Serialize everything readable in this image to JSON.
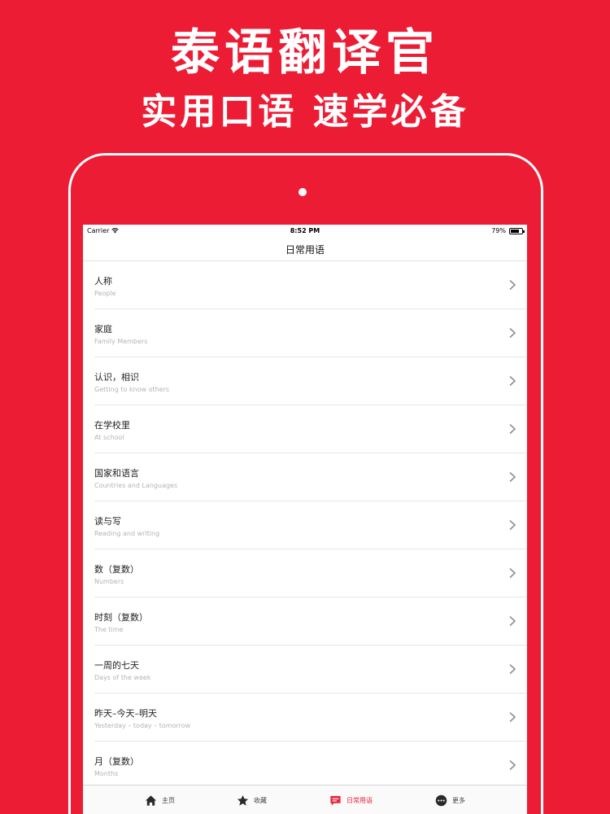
{
  "promo": {
    "title": "泰语翻译官",
    "subtitle": "实用口语 速学必备"
  },
  "status_bar": {
    "carrier": "Carrier",
    "time": "8:52 PM",
    "battery": "79%",
    "battery_level": 0.79
  },
  "nav": {
    "title": "日常用语"
  },
  "list": {
    "items": [
      {
        "title": "人称",
        "subtitle": "People"
      },
      {
        "title": "家庭",
        "subtitle": "Family Members"
      },
      {
        "title": "认识，相识",
        "subtitle": "Getting to know others"
      },
      {
        "title": "在学校里",
        "subtitle": "At school"
      },
      {
        "title": "国家和语言",
        "subtitle": "Countries and Languages"
      },
      {
        "title": "读与写",
        "subtitle": "Reading and writing"
      },
      {
        "title": "数（复数）",
        "subtitle": "Numbers"
      },
      {
        "title": "时刻（复数）",
        "subtitle": "The time"
      },
      {
        "title": "一周的七天",
        "subtitle": "Days of the week"
      },
      {
        "title": "昨天–今天–明天",
        "subtitle": "Yesterday – today – tomorrow"
      },
      {
        "title": "月（复数）",
        "subtitle": "Months"
      }
    ]
  },
  "tab_bar": {
    "tabs": [
      {
        "label": "主页",
        "icon": "home-icon"
      },
      {
        "label": "收藏",
        "icon": "star-icon"
      },
      {
        "label": "日常用语",
        "icon": "chat-icon",
        "active": true
      },
      {
        "label": "更多",
        "icon": "more-icon"
      }
    ]
  },
  "colors": {
    "brand": "#ED1C35",
    "active_tab": "#E8263D"
  }
}
